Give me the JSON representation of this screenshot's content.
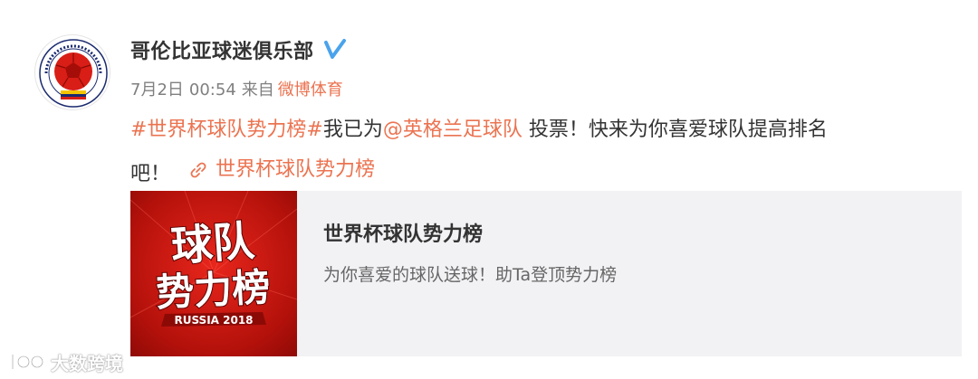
{
  "post": {
    "author_name": "哥伦比亚球迷俱乐部",
    "verified_icon": "verified-badge-icon",
    "date": "7月2日",
    "time": "00:54",
    "source_prefix": "来自",
    "source": "微博体育",
    "hashtag": "#世界杯球队势力榜#",
    "text_part1": "我已为",
    "mention": "@英格兰足球队",
    "text_part2": " 投票！快来为你喜爱球队提高排名",
    "text_part3": "吧！",
    "link_icon": "link-icon",
    "link_text": "世界杯球队势力榜"
  },
  "card": {
    "image_line1": "球队",
    "image_line2": "势力榜",
    "image_badge": "RUSSIA 2018",
    "title": "世界杯球队势力榜",
    "description": "为你喜爱的球队送球！助Ta登顶势力榜"
  },
  "watermark": {
    "text": "大数跨境"
  },
  "colors": {
    "accent": "#eb7350",
    "verified": "#4aa3ec",
    "card_background": "#f2f2f5",
    "card_image_red": "#d81e16"
  }
}
